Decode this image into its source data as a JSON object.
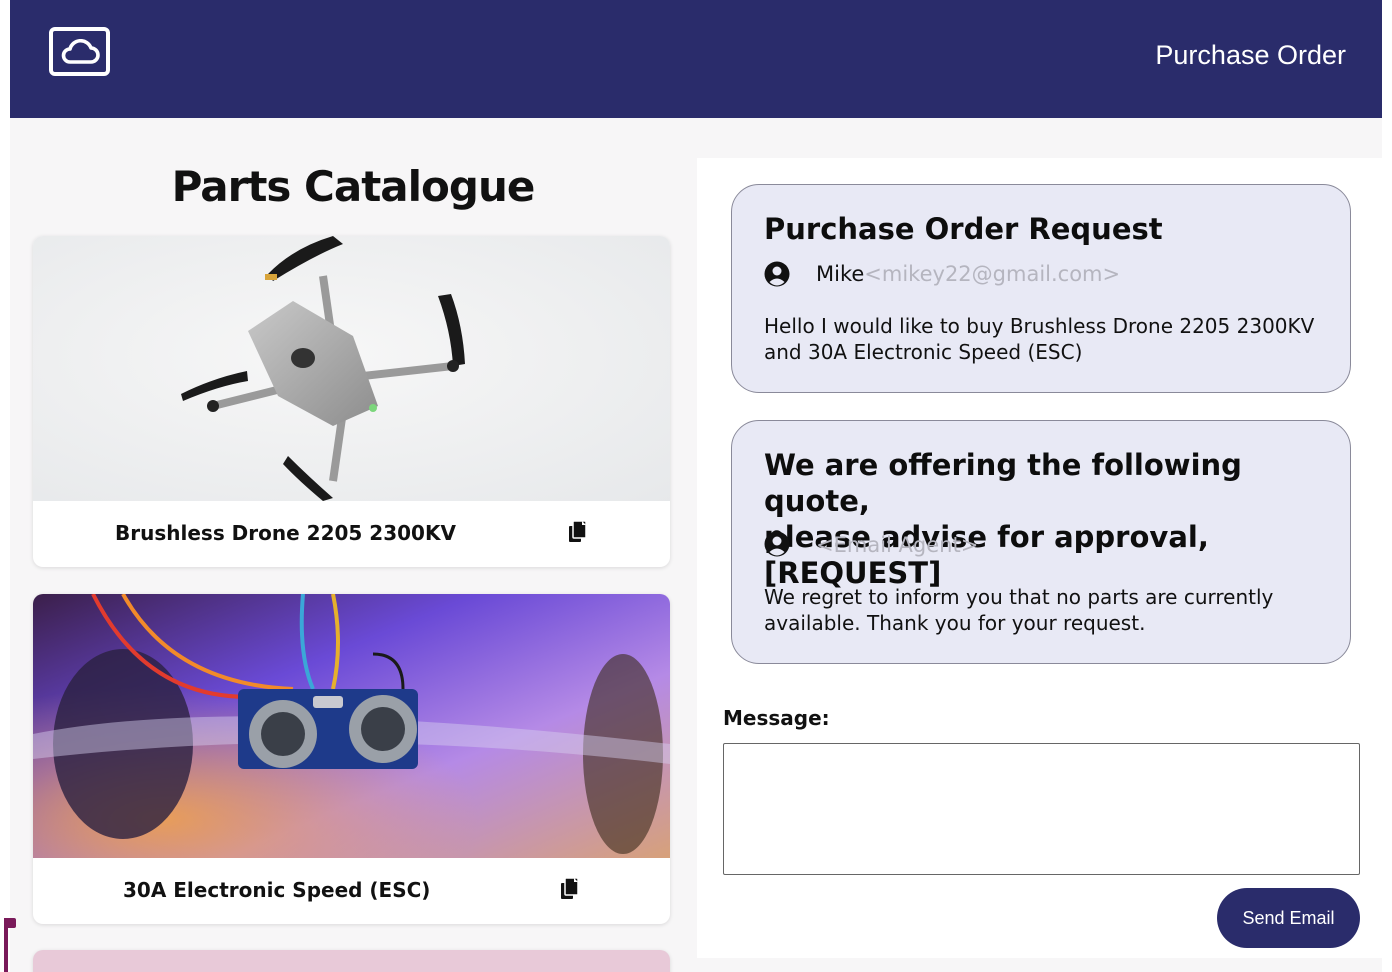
{
  "header": {
    "title": "Purchase Order",
    "logo_icon": "cloud-icon",
    "bg_color": "#2a2c6b"
  },
  "catalogue": {
    "title": "Parts Catalogue",
    "items": [
      {
        "label": "Brushless Drone 2205 2300KV",
        "image": "drone-photo",
        "action_icon": "copy-icon"
      },
      {
        "label": "30A Electronic Speed (ESC)",
        "image": "ultrasonic-sensor-photo",
        "action_icon": "copy-icon"
      }
    ]
  },
  "messages": [
    {
      "heading": "Purchase Order Request",
      "sender_name": "Mike",
      "sender_email": "<mikey22@gmail.com>",
      "body": "Hello I would like to buy Brushless Drone 2205 2300KV and 30A Electronic Speed (ESC)",
      "icon": "user-circle-icon"
    },
    {
      "heading_line1": "We are offering the following quote,",
      "heading_line2": "please advise for approval, [REQUEST]",
      "sender_name": "",
      "sender_email": "<Email Agent>",
      "body": "We regret to inform you that no parts are currently available. Thank you for your request.",
      "icon": "user-circle-icon"
    }
  ],
  "compose": {
    "label": "Message:",
    "value": "",
    "send_label": "Send Email"
  }
}
